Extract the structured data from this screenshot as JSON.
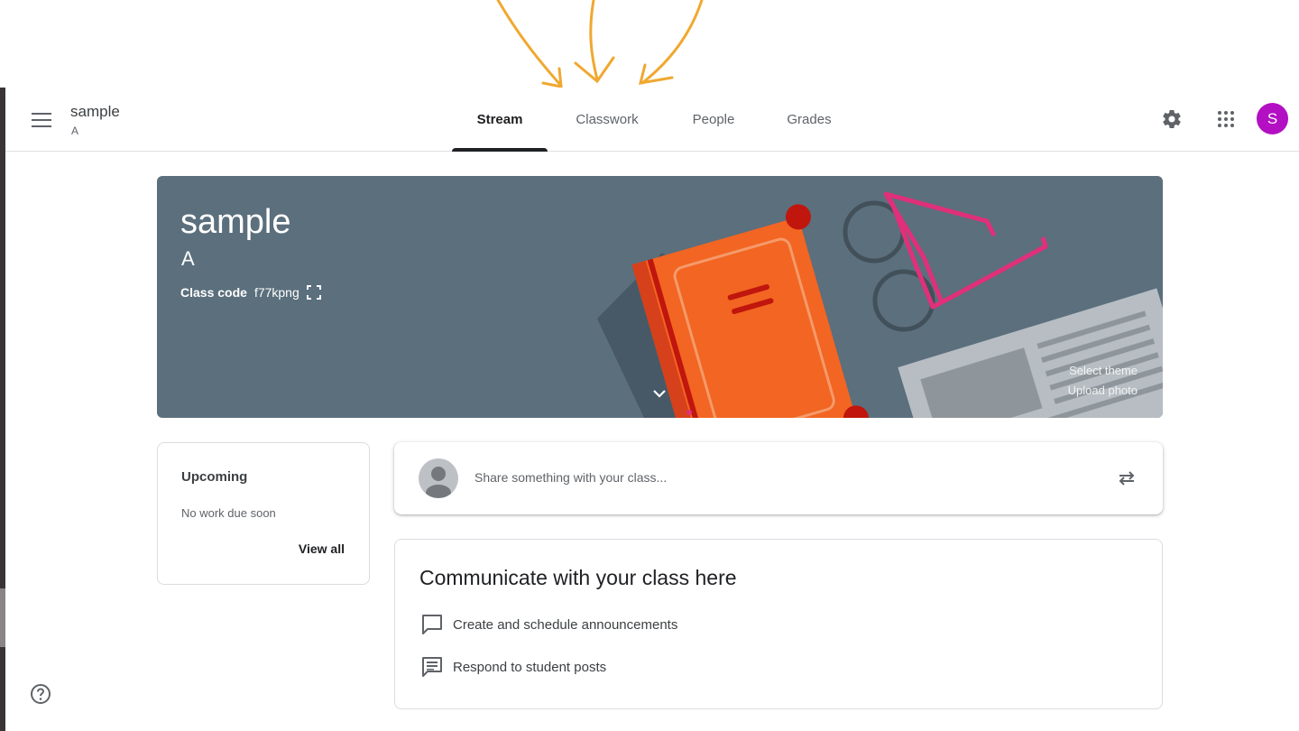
{
  "header": {
    "title": "sample",
    "subtitle": "A",
    "tabs": [
      {
        "label": "Stream",
        "active": true
      },
      {
        "label": "Classwork",
        "active": false
      },
      {
        "label": "People",
        "active": false
      },
      {
        "label": "Grades",
        "active": false
      }
    ],
    "avatar_letter": "S",
    "avatar_color": "#b30fc3"
  },
  "banner": {
    "title": "sample",
    "section": "A",
    "class_code_label": "Class code",
    "class_code": "f77kpng",
    "select_theme": "Select theme",
    "upload_photo": "Upload photo",
    "background_color": "#5b6f7d"
  },
  "upcoming": {
    "heading": "Upcoming",
    "empty_text": "No work due soon",
    "view_all": "View all"
  },
  "share": {
    "placeholder": "Share something with your class..."
  },
  "communicate": {
    "heading": "Communicate with your class here",
    "items": [
      {
        "label": "Create and schedule announcements",
        "icon": "announcement-icon"
      },
      {
        "label": "Respond to student posts",
        "icon": "comment-icon"
      }
    ]
  },
  "icons": {
    "menu": "menu-icon",
    "settings": "gear-icon",
    "apps": "apps-grid-icon",
    "help": "help-icon",
    "repost": "repost-icon",
    "expand": "chevron-down-icon",
    "fullscreen": "fullscreen-icon"
  },
  "accent_arrow_color": "#f0a830"
}
